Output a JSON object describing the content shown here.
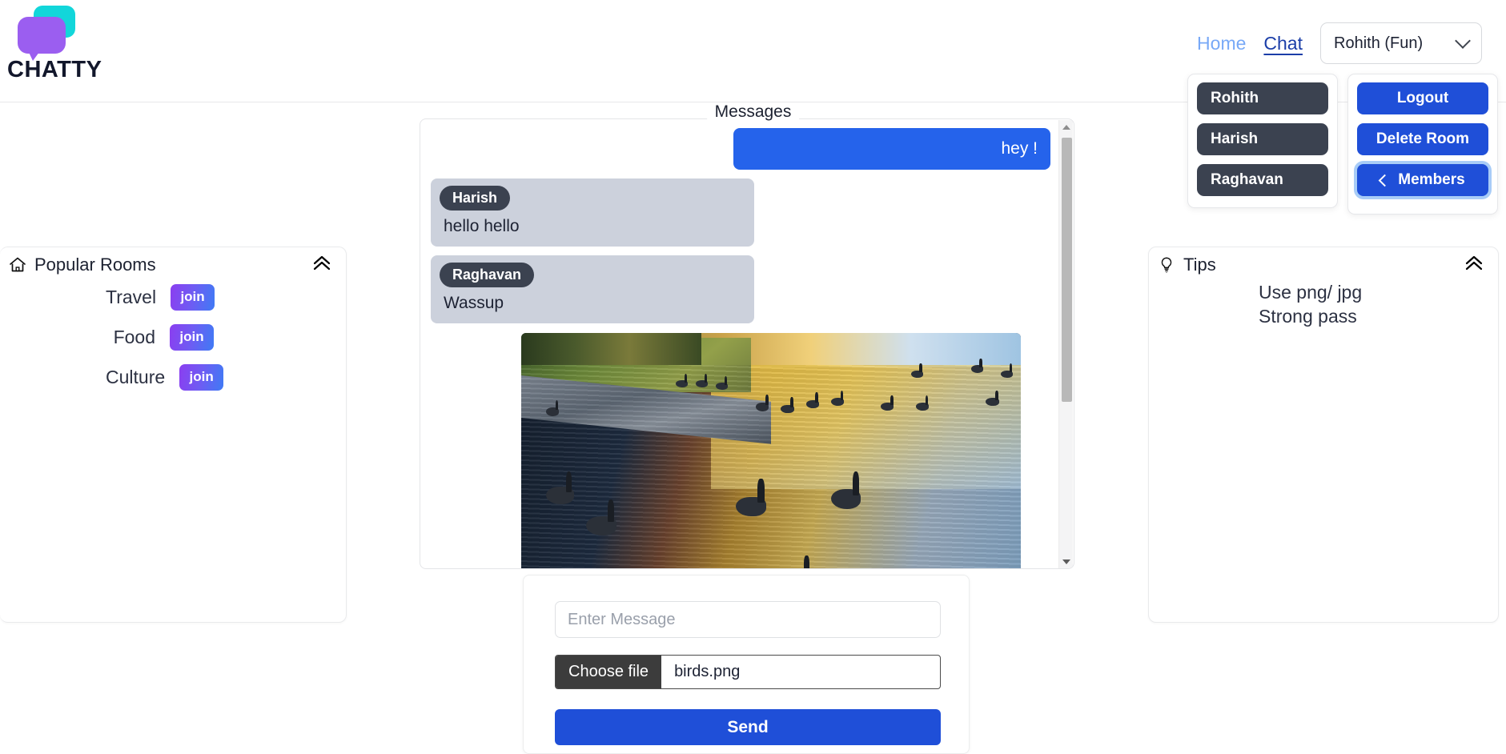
{
  "brand": {
    "name": "CHATTY",
    "logo_icon": "chat-bubble-logo"
  },
  "nav": {
    "home_label": "Home",
    "chat_label": "Chat",
    "user_select_value": "Rohith (Fun)",
    "chevron_icon": "chevron-down-icon"
  },
  "members_panel": {
    "members": [
      {
        "name": "Rohith"
      },
      {
        "name": "Harish"
      },
      {
        "name": "Raghavan"
      }
    ]
  },
  "actions_panel": {
    "logout_label": "Logout",
    "delete_room_label": "Delete Room",
    "members_label": "Members",
    "members_chevron_icon": "chevron-left-icon"
  },
  "popular_rooms": {
    "title": "Popular Rooms",
    "home_icon": "home-icon",
    "collapse_icon": "double-chevron-up-icon",
    "rooms": [
      {
        "name": "Travel",
        "join_label": "join"
      },
      {
        "name": "Food",
        "join_label": "join"
      },
      {
        "name": "Culture",
        "join_label": "join"
      }
    ]
  },
  "tips": {
    "title": "Tips",
    "bulb_icon": "lightbulb-icon",
    "collapse_icon": "double-chevron-up-icon",
    "lines": [
      "Use png/ jpg",
      "Strong pass"
    ]
  },
  "chat": {
    "legend": "Messages",
    "messages": [
      {
        "direction": "out",
        "sender": "",
        "text": "hey !"
      },
      {
        "direction": "in",
        "sender": "Harish",
        "text": "hello hello"
      },
      {
        "direction": "in",
        "sender": "Raghavan",
        "text": "Wassup"
      },
      {
        "direction": "in",
        "sender": "",
        "text": "",
        "attachment": "birds-photo"
      }
    ],
    "scrollbar": {
      "up_icon": "scroll-up-arrow-icon",
      "down_icon": "scroll-down-arrow-icon"
    }
  },
  "composer": {
    "message_placeholder": "Enter Message",
    "message_value": "",
    "choose_file_label": "Choose file",
    "file_name": "birds.png",
    "send_label": "Send"
  },
  "colors": {
    "primary_blue": "#1f4fd8",
    "bubble_blue": "#2563eb",
    "dark_chip": "#3b4250",
    "bubble_grey": "#ccd1dc",
    "nav_link": "#78a9f7",
    "nav_active": "#1b3ea8",
    "logo_purple": "#9b5ef0",
    "logo_teal": "#12d6da"
  }
}
